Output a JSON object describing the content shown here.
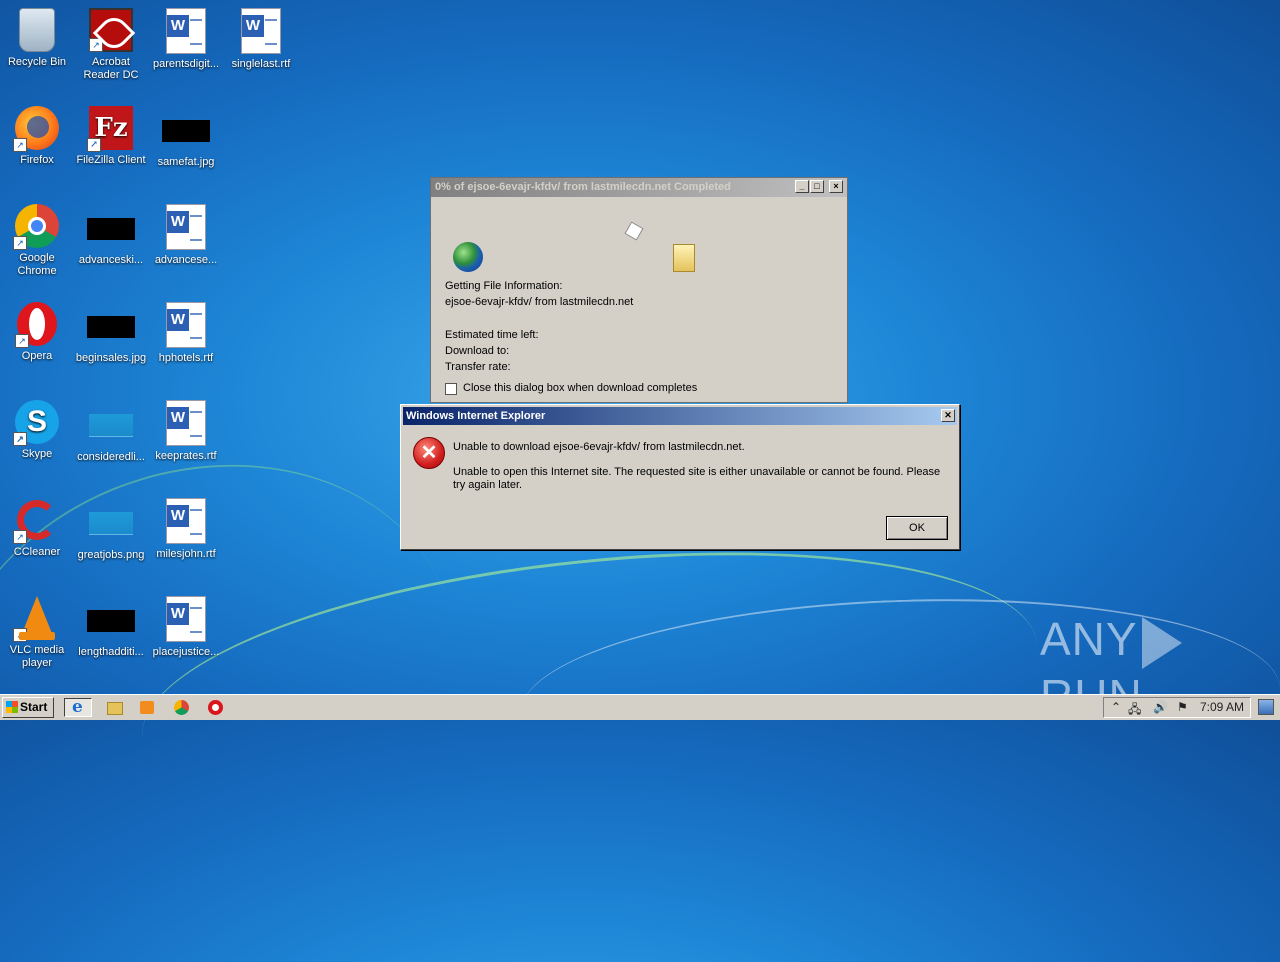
{
  "desktop": {
    "icons": [
      {
        "label": "Recycle Bin",
        "icon": "recycle-bin-icon"
      },
      {
        "label": "Acrobat Reader DC",
        "icon": "acrobat-icon"
      },
      {
        "label": "parentsdigit...",
        "icon": "word-doc-icon"
      },
      {
        "label": "singlelast.rtf",
        "icon": "word-doc-icon"
      },
      {
        "label": "Firefox",
        "icon": "firefox-icon"
      },
      {
        "label": "FileZilla Client",
        "icon": "filezilla-icon"
      },
      {
        "label": "samefat.jpg",
        "icon": "image-thumbnail-icon"
      },
      {
        "label": "Google Chrome",
        "icon": "chrome-icon"
      },
      {
        "label": "advanceski...",
        "icon": "image-thumbnail-icon"
      },
      {
        "label": "advancese...",
        "icon": "word-doc-icon"
      },
      {
        "label": "Opera",
        "icon": "opera-icon"
      },
      {
        "label": "beginsales.jpg",
        "icon": "image-thumbnail-icon"
      },
      {
        "label": "hphotels.rtf",
        "icon": "word-doc-icon"
      },
      {
        "label": "Skype",
        "icon": "skype-icon"
      },
      {
        "label": "consideredli...",
        "icon": "image-thumbnail-icon"
      },
      {
        "label": "keeprates.rtf",
        "icon": "word-doc-icon"
      },
      {
        "label": "CCleaner",
        "icon": "ccleaner-icon"
      },
      {
        "label": "greatjobs.png",
        "icon": "image-thumbnail-icon"
      },
      {
        "label": "milesjohn.rtf",
        "icon": "word-doc-icon"
      },
      {
        "label": "VLC media player",
        "icon": "vlc-icon"
      },
      {
        "label": "lengthadditi...",
        "icon": "image-thumbnail-icon"
      },
      {
        "label": "placejustice...",
        "icon": "word-doc-icon"
      }
    ],
    "word_glyph": "W",
    "filezilla_glyph": "Fz",
    "skype_glyph": "S",
    "shortcut_arrow": "↗"
  },
  "download_dialog": {
    "title": "0% of ejsoe-6evajr-kfdv/ from lastmilecdn.net Completed",
    "status": "Getting File Information:",
    "file": "ejsoe-6evajr-kfdv/ from lastmilecdn.net",
    "time_left": "Estimated time left:",
    "download_to": "Download to:",
    "transfer_rate": "Transfer rate:",
    "close_when_done": "Close this dialog box when download completes",
    "close_when_done_checked": false
  },
  "error_dialog": {
    "title": "Windows Internet Explorer",
    "message1": "Unable to download ejsoe-6evajr-kfdv/ from lastmilecdn.net.",
    "message2": "Unable to open this Internet site.  The requested site is either unavailable or cannot be found.  Please try again later.",
    "ok_label": "OK",
    "close_glyph": "✕",
    "error_glyph": "✕"
  },
  "taskbar": {
    "start_label": "Start",
    "clock": "7:09 AM",
    "tray_glyphs": [
      "⌃",
      "🖧",
      "🔊",
      "⚑"
    ]
  },
  "watermark": {
    "left": "ANY",
    "right": "RUN"
  }
}
